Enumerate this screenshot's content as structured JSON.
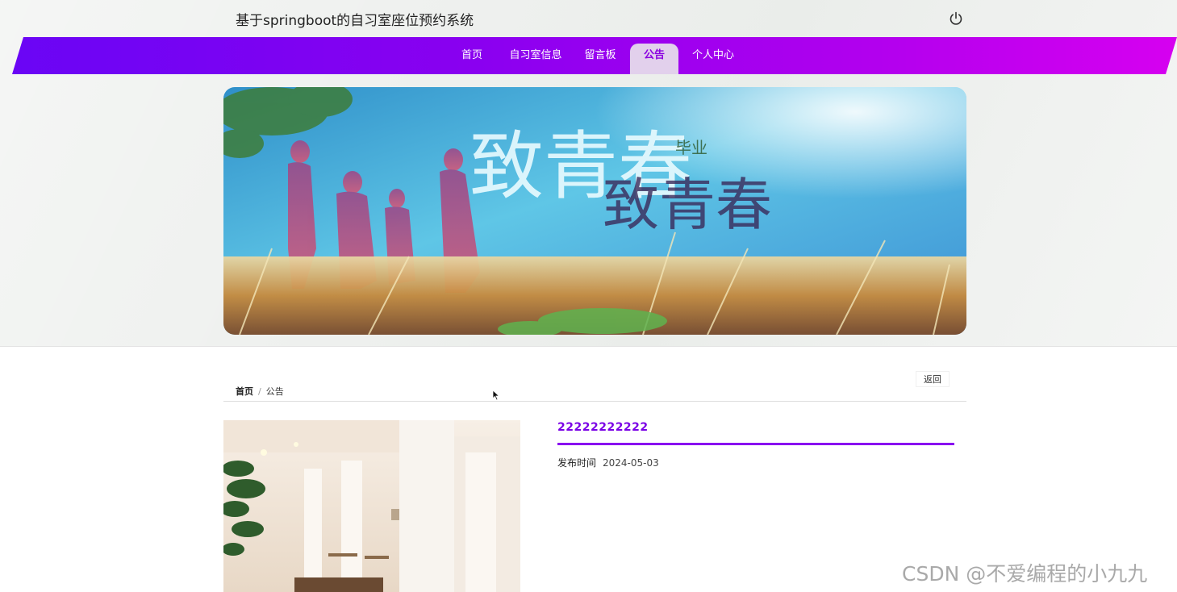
{
  "header": {
    "site_title": "基于springboot的自习室座位预约系统",
    "power_icon": "power-icon"
  },
  "nav": {
    "items": [
      {
        "label": "首页"
      },
      {
        "label": "自习室信息"
      },
      {
        "label": "留言板"
      },
      {
        "label": "公告",
        "active": true
      },
      {
        "label": "个人中心"
      }
    ],
    "colors": {
      "start": "#6a05f5",
      "end": "#d600f0",
      "active_bg": "#e2d0ec",
      "active_text": "#8b00e0"
    }
  },
  "banner": {
    "headline": "致青春",
    "sub_1": "致青春",
    "sub_2": "毕业"
  },
  "breadcrumb": {
    "home": "首页",
    "separator": "/",
    "current": "公告"
  },
  "back_label": "返回",
  "notice": {
    "title": "22222222222",
    "publish_label": "发布时间",
    "publish_date": "2024-05-03"
  },
  "watermark": "CSDN @不爱编程的小九九",
  "accent_color": "#8a00f0"
}
